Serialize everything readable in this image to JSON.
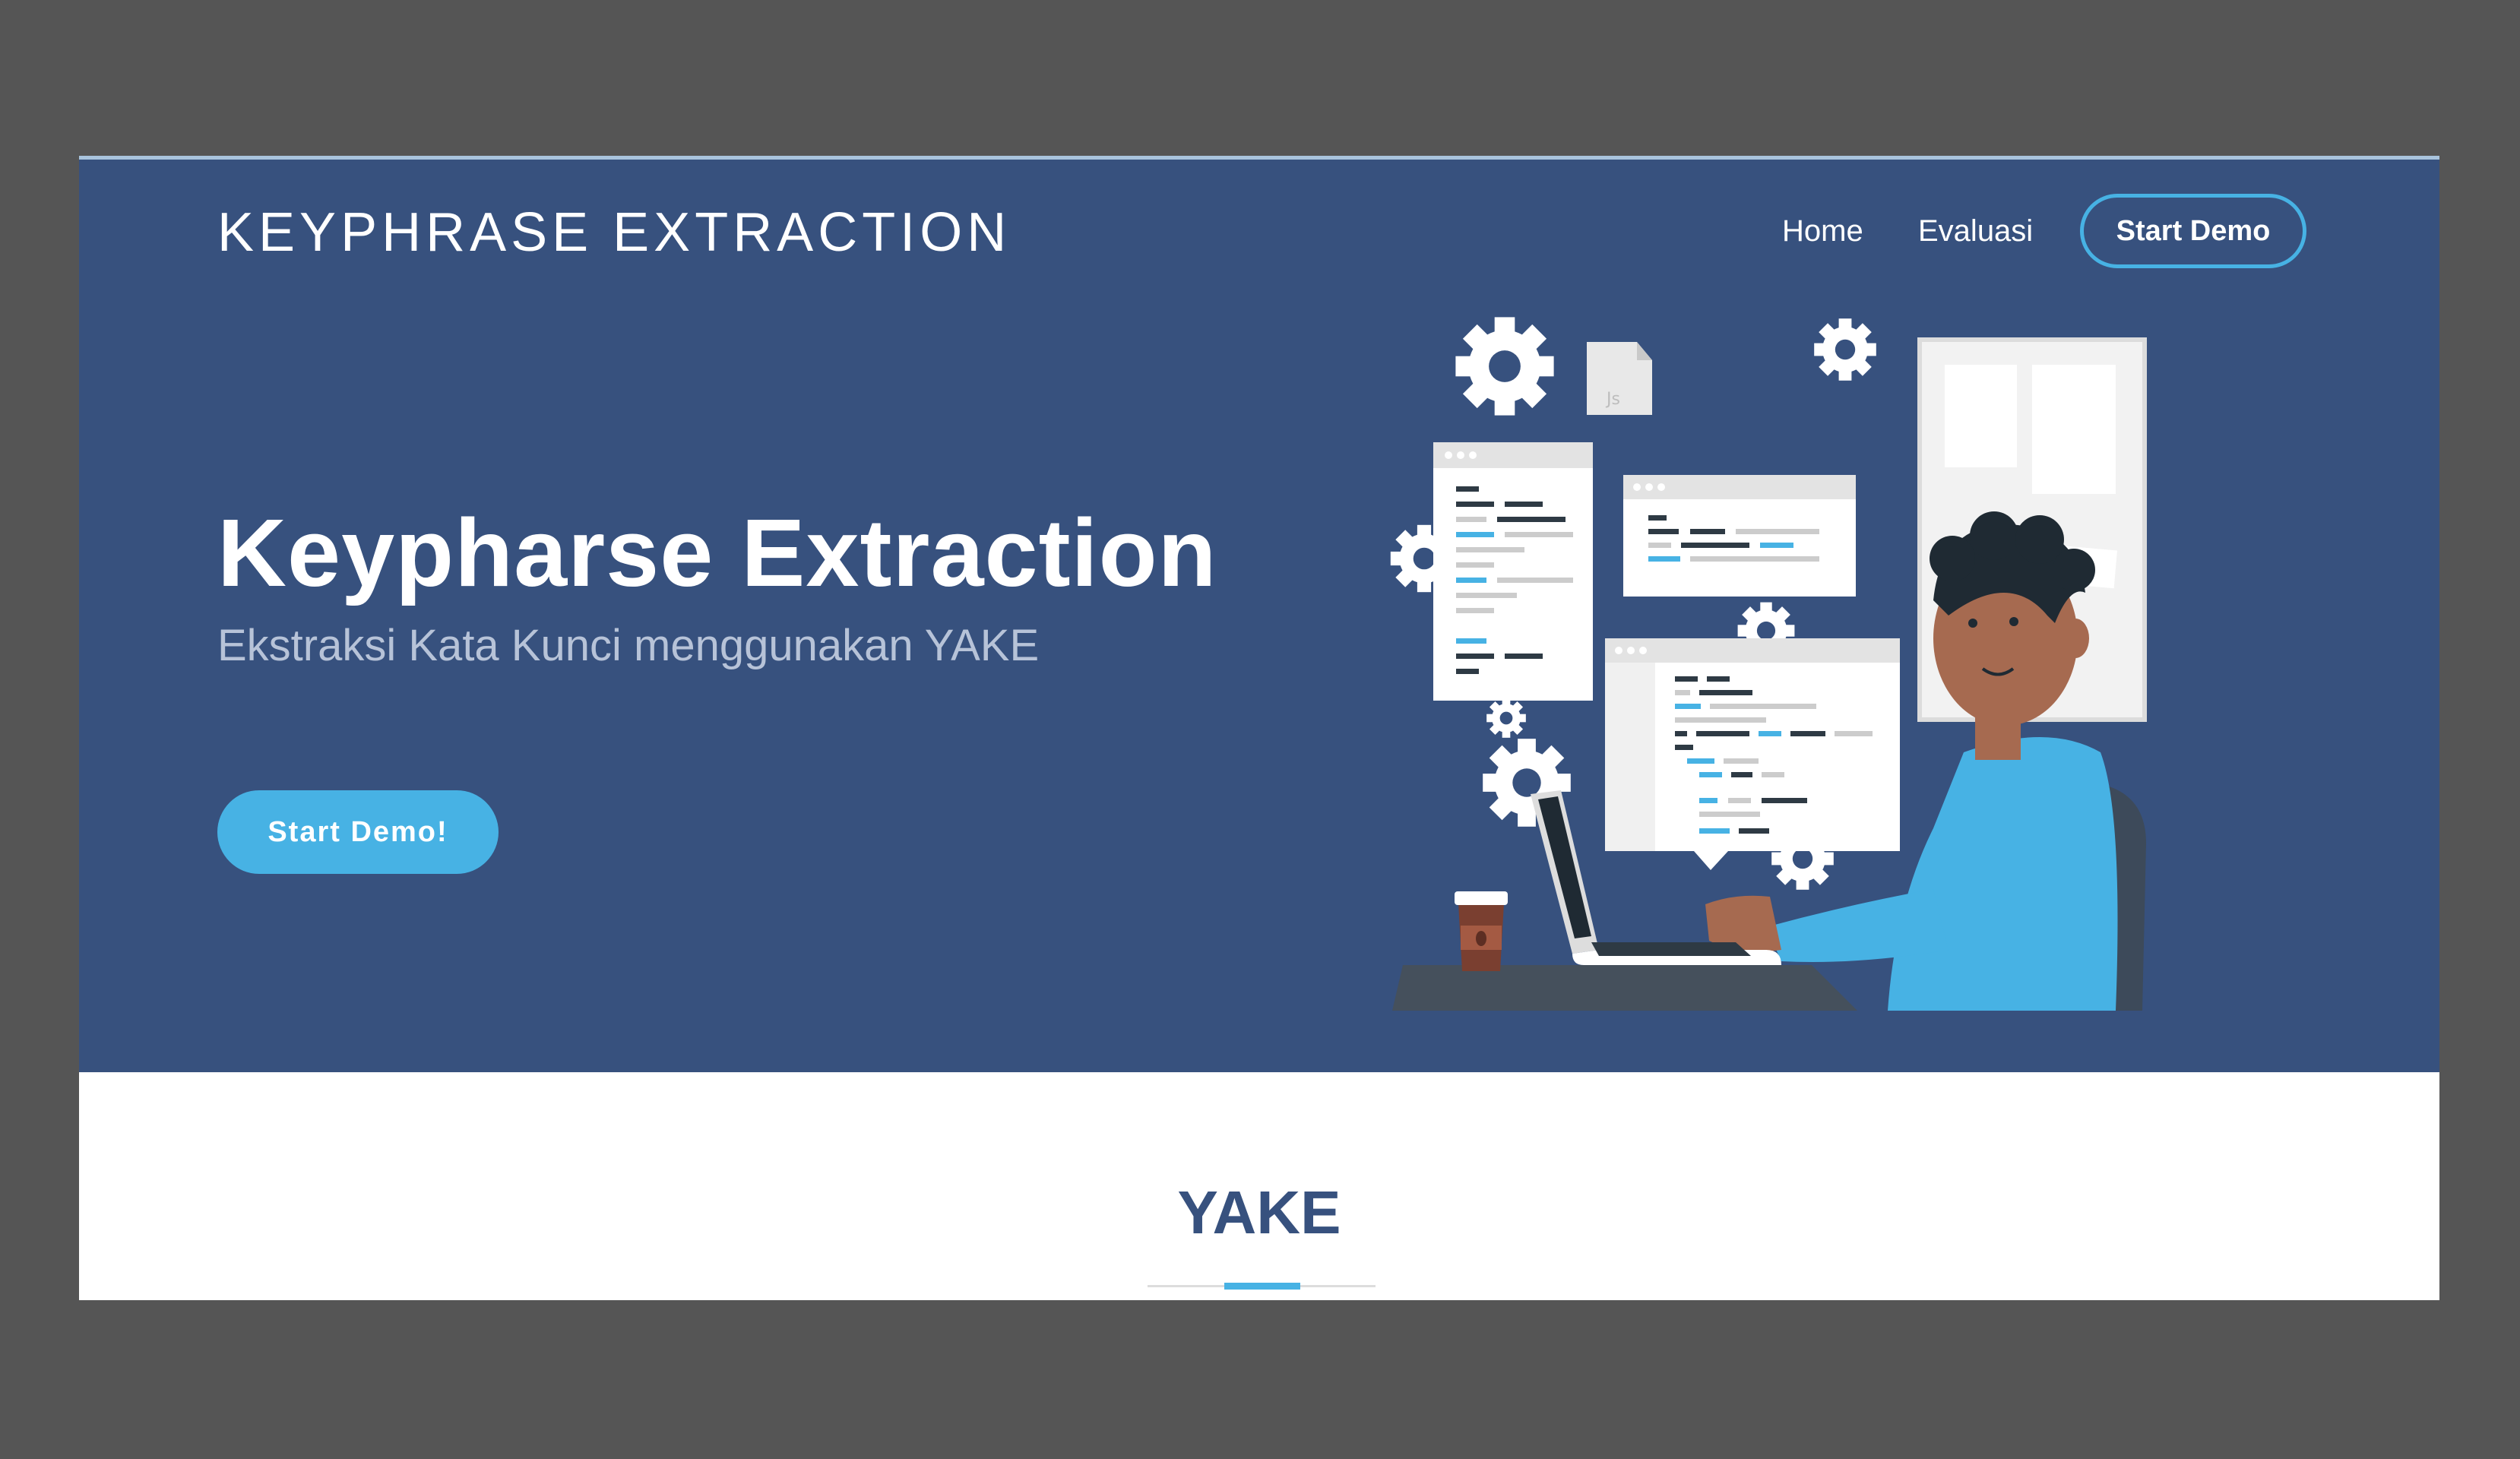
{
  "header": {
    "brand": "KEYPHRASE EXTRACTION",
    "nav": {
      "home": "Home",
      "evaluasi": "Evaluasi",
      "start_demo": "Start Demo"
    }
  },
  "hero": {
    "title": "Keypharse Extraction",
    "subtitle": "Ekstraksi Kata Kunci menggunakan YAKE",
    "button": "Start Demo!",
    "illustration": "developer-at-laptop-illustration",
    "illustration_file_label": "Js"
  },
  "section": {
    "title": "YAKE"
  },
  "colors": {
    "hero_bg": "#37517e",
    "accent": "#47b2e4",
    "page_bg": "#555555",
    "section_title": "#37517e"
  }
}
